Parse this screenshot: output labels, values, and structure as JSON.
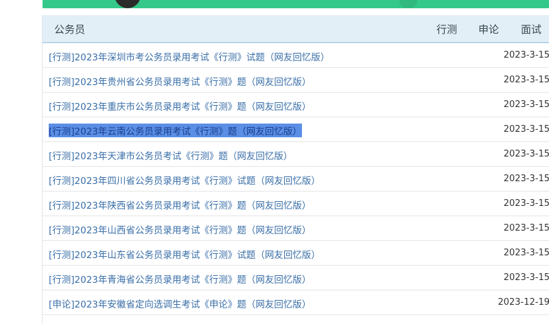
{
  "panel": {
    "title": "公务员",
    "tabs": [
      "行测",
      "申论",
      "面试"
    ]
  },
  "articles": [
    {
      "title": "[行测]2023年深圳市考公务员录用考试《行测》试题（网友回忆版）",
      "date": "2023-3-15"
    },
    {
      "title": "[行测]2023年贵州省公务员录用考试《行测》题（网友回忆版）",
      "date": "2023-3-15"
    },
    {
      "title": "[行测]2023年重庆市公务员录用考试《行测》题（网友回忆版）",
      "date": "2023-3-15"
    },
    {
      "title": "[行测]2023年云南公务员录用考试《行测》题（网友回忆版）",
      "date": "2023-3-15",
      "selected": true
    },
    {
      "title": "[行测]2023年天津市公务员考试《行测》题（网友回忆版）",
      "date": "2023-3-15"
    },
    {
      "title": "[行测]2023年四川省公务员录用考试《行测》试题（网友回忆版）",
      "date": "2023-3-15"
    },
    {
      "title": "[行测]2023年陕西省公务员录用考试《行测》题（网友回忆版）",
      "date": "2023-3-15"
    },
    {
      "title": "[行测]2023年山西省公务员录用考试《行测》题（网友回忆版）",
      "date": "2023-3-15"
    },
    {
      "title": "[行测]2023年山东省公务员录用考试《行测》试题（网友回忆版）",
      "date": "2023-3-15"
    },
    {
      "title": "[行测]2023年青海省公务员录用考试《行测》题（网友回忆版）",
      "date": "2023-3-15"
    },
    {
      "title": "[申论]2023年安徽省定向选调生考试《申论》题（网友回忆版）",
      "date": "2023-12-19"
    }
  ]
}
